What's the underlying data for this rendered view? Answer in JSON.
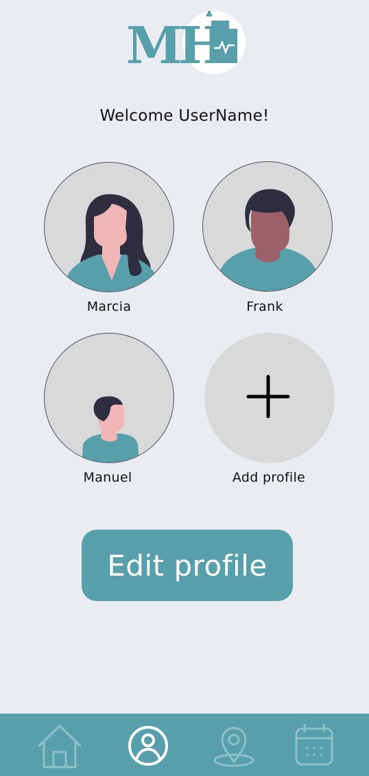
{
  "header": {
    "logo_text": "MH",
    "welcome": "Welcome UserName!"
  },
  "profiles": [
    {
      "name": "Marcia",
      "icon": "woman-avatar-icon"
    },
    {
      "name": "Frank",
      "icon": "man-avatar-icon"
    },
    {
      "name": "Manuel",
      "icon": "boy-avatar-icon"
    }
  ],
  "add_profile": {
    "label": "Add profile",
    "icon": "plus-icon"
  },
  "edit_button": {
    "label": "Edit profile"
  },
  "nav": {
    "items": [
      {
        "icon": "home-icon",
        "active": false
      },
      {
        "icon": "user-circle-icon",
        "active": true
      },
      {
        "icon": "location-pin-icon",
        "active": false
      },
      {
        "icon": "calendar-icon",
        "active": false
      }
    ]
  },
  "colors": {
    "accent": "#569fab",
    "background": "#e9ecf1",
    "avatar_bg": "#d9d9d9",
    "hair": "#2f2e41",
    "skin_light": "#f0b5b5",
    "skin_dark": "#9b6068",
    "nav_inactive": "#8fc0c8"
  }
}
